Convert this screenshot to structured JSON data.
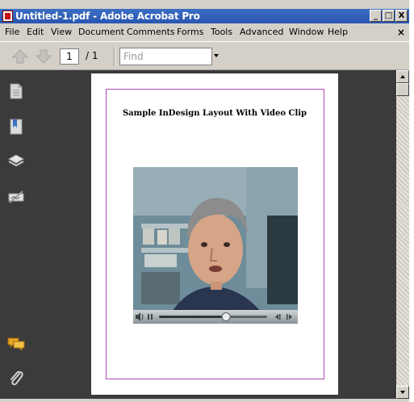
{
  "window": {
    "title": "Untitled-1.pdf - Adobe Acrobat Pro",
    "minimize_glyph": "_",
    "maximize_glyph": "□",
    "close_glyph": "X"
  },
  "menu": {
    "items": [
      "File",
      "Edit",
      "View",
      "Document",
      "Comments",
      "Forms",
      "Tools",
      "Advanced",
      "Window",
      "Help"
    ],
    "close_glyph": "×"
  },
  "toolbar": {
    "page_number": "1",
    "page_total": "/ 1",
    "find_placeholder": "Find"
  },
  "left_nav": {
    "icons": [
      "pages-icon",
      "bookmarks-icon",
      "layers-icon",
      "signatures-icon",
      "comments-icon",
      "attachments-icon"
    ]
  },
  "document": {
    "heading": "Sample InDesign Layout With Video Clip",
    "margin_color": "#b14bb1",
    "video_progress": 0.62
  },
  "colors": {
    "titlebar": "#2a56b0",
    "chrome": "#d4d0c8",
    "navpanel": "#3b3b3b"
  }
}
